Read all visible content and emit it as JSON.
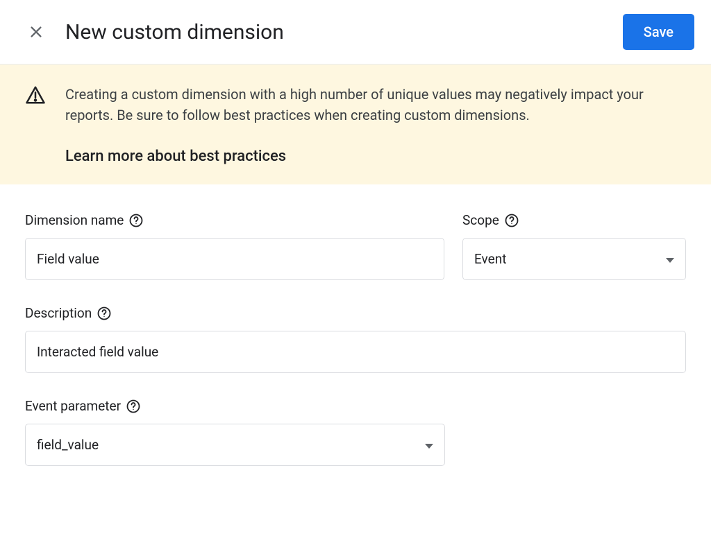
{
  "header": {
    "title": "New custom dimension",
    "save_label": "Save"
  },
  "banner": {
    "text": "Creating a custom dimension with a high number of unique values may negatively impact your reports. Be sure to follow best practices when creating custom dimensions.",
    "link": "Learn more about best practices"
  },
  "form": {
    "dimension_name": {
      "label": "Dimension name",
      "value": "Field value"
    },
    "scope": {
      "label": "Scope",
      "value": "Event"
    },
    "description": {
      "label": "Description",
      "value": "Interacted field value"
    },
    "event_parameter": {
      "label": "Event parameter",
      "value": "field_value"
    }
  }
}
